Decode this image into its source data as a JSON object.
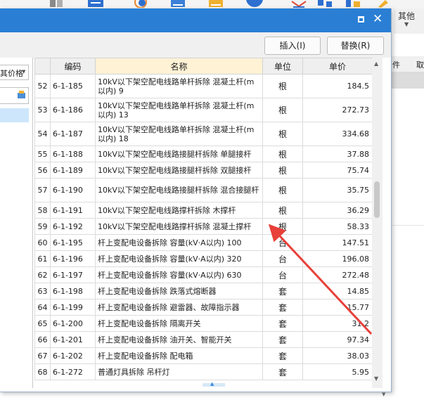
{
  "background_app": {
    "other_label": "其他",
    "right_headers": [
      "件",
      "取"
    ]
  },
  "dialog": {
    "insert_label": "插入(I)",
    "replace_label": "替换(R)",
    "left_combo_text": "其价格",
    "columns": [
      "",
      "编码",
      "名称",
      "单位",
      "单价"
    ],
    "rows": [
      {
        "idx": "52",
        "code": "6-1-185",
        "name": "10kV以下架空配电线路单杆拆除 混凝土杆(m以内) 9",
        "unit": "根",
        "price": "184.5"
      },
      {
        "idx": "53",
        "code": "6-1-186",
        "name": "10kV以下架空配电线路单杆拆除 混凝土杆(m以内) 13",
        "unit": "根",
        "price": "272.73"
      },
      {
        "idx": "54",
        "code": "6-1-187",
        "name": "10kV以下架空配电线路单杆拆除 混凝土杆(m以内) 18",
        "unit": "根",
        "price": "334.68"
      },
      {
        "idx": "55",
        "code": "6-1-188",
        "name": "10kV以下架空配电线路接腿杆拆除 单腿接杆",
        "unit": "根",
        "price": "37.88"
      },
      {
        "idx": "56",
        "code": "6-1-189",
        "name": "10kV以下架空配电线路接腿杆拆除 双腿接杆",
        "unit": "根",
        "price": "75.74"
      },
      {
        "idx": "57",
        "code": "6-1-190",
        "name": "10kV以下架空配电线路接腿杆拆除 混合接腿杆",
        "unit": "根",
        "price": "35.75"
      },
      {
        "idx": "58",
        "code": "6-1-191",
        "name": "10kV以下架空配电线路撑杆拆除 木撑杆",
        "unit": "根",
        "price": "36.29"
      },
      {
        "idx": "59",
        "code": "6-1-192",
        "name": "10kV以下架空配电线路撑杆拆除 混凝土撑杆",
        "unit": "根",
        "price": "58.33"
      },
      {
        "idx": "60",
        "code": "6-1-195",
        "name": "杆上变配电设备拆除 容量(kV·A以内) 100",
        "unit": "台",
        "price": "147.51"
      },
      {
        "idx": "61",
        "code": "6-1-196",
        "name": "杆上变配电设备拆除 容量(kV·A以内) 320",
        "unit": "台",
        "price": "196.08"
      },
      {
        "idx": "62",
        "code": "6-1-197",
        "name": "杆上变配电设备拆除 容量(kV·A以内) 630",
        "unit": "台",
        "price": "272.48"
      },
      {
        "idx": "63",
        "code": "6-1-198",
        "name": "杆上变配电设备拆除 跌落式熔断器",
        "unit": "套",
        "price": "14.85"
      },
      {
        "idx": "64",
        "code": "6-1-199",
        "name": "杆上变配电设备拆除 避雷器、故障指示器",
        "unit": "套",
        "price": "15.77"
      },
      {
        "idx": "65",
        "code": "6-1-200",
        "name": "杆上变配电设备拆除 隔离开关",
        "unit": "套",
        "price": "31.2"
      },
      {
        "idx": "66",
        "code": "6-1-201",
        "name": "杆上变配电设备拆除 油开关、智能开关",
        "unit": "套",
        "price": "97.34"
      },
      {
        "idx": "67",
        "code": "6-1-202",
        "name": "杆上变配电设备拆除 配电箱",
        "unit": "套",
        "price": "38.03"
      },
      {
        "idx": "68",
        "code": "6-1-272",
        "name": "普通灯具拆除 吊杆灯",
        "unit": "套",
        "price": "5.95"
      }
    ]
  },
  "colors": {
    "titlebar": "#2a7fd4",
    "name_header": "#fff2d5",
    "annotation_arrow": "#e8403a"
  }
}
